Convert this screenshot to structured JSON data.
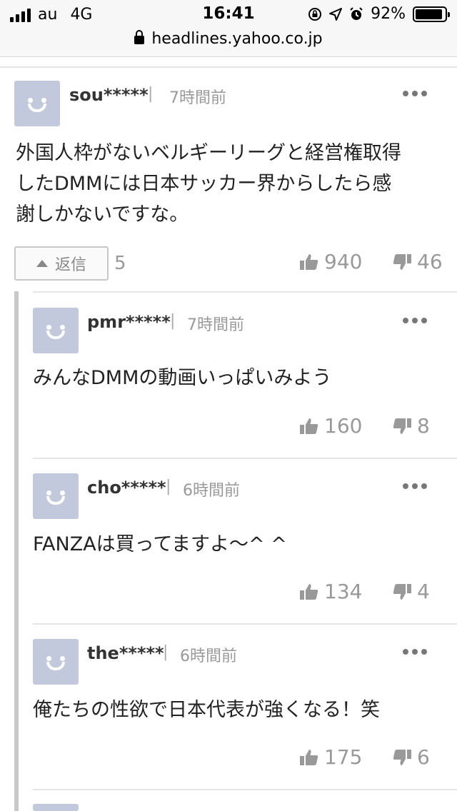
{
  "status_bar": {
    "carrier": "au",
    "network": "4G",
    "time": "16:41",
    "battery": "92%",
    "battery_fraction": 0.92
  },
  "browser": {
    "url": "headlines.yahoo.co.jp"
  },
  "main_comment": {
    "username": "sou*****",
    "time": "7時間前",
    "text_lines": [
      "外国人枠がないベルギーリーグと経営権取得",
      "したDMMには日本サッカー界からしたら感",
      "謝しかないですな。"
    ],
    "reply_label": "返信",
    "reply_count": "5",
    "likes": "940",
    "dislikes": "46"
  },
  "replies": [
    {
      "username": "pmr*****",
      "time": "7時間前",
      "text": "みんなDMMの動画いっぱいみよう",
      "likes": "160",
      "dislikes": "8"
    },
    {
      "username": "cho*****",
      "time": "6時間前",
      "text": "FANZAは買ってますよ〜^ ^",
      "likes": "134",
      "dislikes": "4"
    },
    {
      "username": "the*****",
      "time": "6時間前",
      "text": "俺たちの性欲で日本代表が強くなる！笑",
      "likes": "175",
      "dislikes": "6"
    }
  ],
  "icons": {
    "like": "thumbs-up-icon",
    "dislike": "thumbs-down-icon",
    "more": "more-dots-icon",
    "lock": "lock-icon"
  }
}
